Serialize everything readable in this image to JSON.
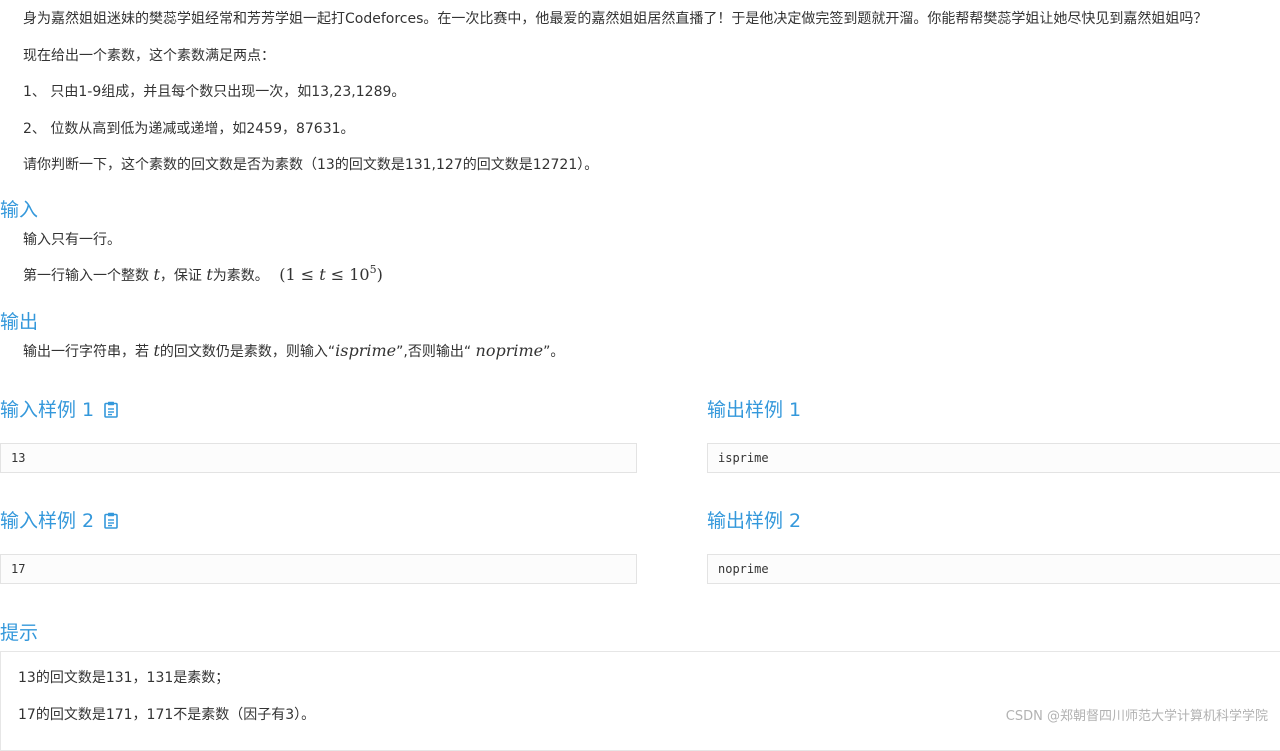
{
  "description": {
    "intro": "身为嘉然姐姐迷妹的樊蕊学姐经常和芳芳学姐一起打Codeforces。在一次比赛中，他最爱的嘉然姐姐居然直播了！于是他决定做完签到题就开溜。你能帮帮樊蕊学姐让她尽快见到嘉然姐姐吗？",
    "given": "现在给出一个素数，这个素数满足两点：",
    "rule1": "1、 只由1-9组成，并且每个数只出现一次，如13,23,1289。",
    "rule2": "2、 位数从高到低为递减或递增，如2459，87631。",
    "judge": "请你判断一下，这个素数的回文数是否为素数（13的回文数是131,127的回文数是12721）。"
  },
  "input_section": {
    "title": "输入",
    "line1": "输入只有一行。",
    "line2_prefix": "第一行输入一个整数 ",
    "line2_var1": "t",
    "line2_mid": "，保证 ",
    "line2_var2": "t",
    "line2_suffix": "为素数。",
    "constraint_open": "(1 ≤ ",
    "constraint_var": "t",
    "constraint_mid": " ≤ 10",
    "constraint_exp": "5",
    "constraint_close": ")"
  },
  "output_section": {
    "title": "输出",
    "prefix": "输出一行字符串，若 ",
    "var": "t",
    "mid1": "的回文数仍是素数，则输入“",
    "word1": "isprime",
    "mid2": "”,否则输出“ ",
    "word2": "noprime",
    "suffix": "”。"
  },
  "samples": [
    {
      "input_title": "输入样例 1",
      "output_title": "输出样例 1",
      "input": "13",
      "output": "isprime"
    },
    {
      "input_title": "输入样例 2",
      "output_title": "输出样例 2",
      "input": "17",
      "output": "noprime"
    }
  ],
  "hint": {
    "title": "提示",
    "line1": "13的回文数是131，131是素数；",
    "line2": "17的回文数是171，171不是素数（因子有3）。"
  },
  "watermark": "CSDN @郑朝督四川师范大学计算机科学学院",
  "colors": {
    "accent": "#3498db",
    "text": "#333333",
    "watermark": "#b2b2b2"
  },
  "icons": {
    "copy": "clipboard-icon"
  }
}
